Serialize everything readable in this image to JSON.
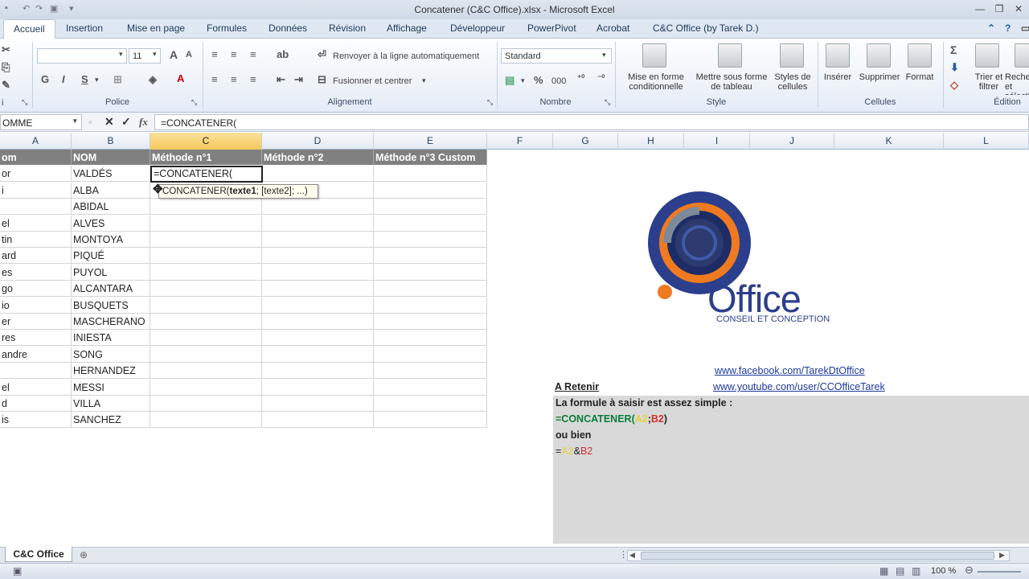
{
  "window": {
    "title": "Concatener (C&C Office).xlsx - Microsoft Excel"
  },
  "ribbon_tabs": [
    "Accueil",
    "Insertion",
    "Mise en page",
    "Formules",
    "Données",
    "Révision",
    "Affichage",
    "Développeur",
    "PowerPivot",
    "Acrobat",
    "C&C Office (by Tarek D.)"
  ],
  "ribbon": {
    "font_size": "11",
    "bold": "G",
    "italic": "I",
    "underline": "S",
    "wrap_text": "Renvoyer à la ligne automatiquement",
    "merge_center": "Fusionner et centrer",
    "number_format": "Standard",
    "percent": "%",
    "thousands": "000",
    "cond_format": "Mise en forme conditionnelle",
    "table_format": "Mettre sous forme de tableau",
    "cell_styles": "Styles de cellules",
    "insert": "Insérer",
    "delete": "Supprimer",
    "format": "Format",
    "sort_filter": "Trier et filtrer",
    "find_select": "Rechercher et sélectionner",
    "groups": {
      "police": "Police",
      "alignement": "Alignement",
      "nombre": "Nombre",
      "style": "Style",
      "cellules": "Cellules",
      "edition": "Édition"
    }
  },
  "formula_bar": {
    "name_box": "OMME",
    "fx": "fx",
    "formula": "=CONCATENER("
  },
  "columns": [
    "A",
    "B",
    "C",
    "D",
    "E",
    "F",
    "G",
    "H",
    "I",
    "J",
    "K",
    "L"
  ],
  "table": {
    "headers": [
      "om",
      "NOM",
      "Méthode n°1",
      "Méthode n°2",
      "Méthode n°3 Custom"
    ],
    "rows": [
      [
        "or",
        "VALDÉS"
      ],
      [
        "i",
        "ALBA"
      ],
      [
        "",
        "ABIDAL"
      ],
      [
        "el",
        "ALVES"
      ],
      [
        "tin",
        "MONTOYA"
      ],
      [
        "ard",
        "PIQUÉ"
      ],
      [
        "es",
        "PUYOL"
      ],
      [
        "go",
        "ALCANTARA"
      ],
      [
        "io",
        "BUSQUETS"
      ],
      [
        "er",
        "MASCHERANO"
      ],
      [
        "res",
        "INIESTA"
      ],
      [
        "andre",
        "SONG"
      ],
      [
        "",
        "HERNANDEZ"
      ],
      [
        "el",
        "MESSI"
      ],
      [
        "d",
        "VILLA"
      ],
      [
        "is",
        "SANCHEZ"
      ]
    ],
    "editing_value": "=CONCATENER(",
    "tooltip_func": "CONCATENER(",
    "tooltip_arg1": "texte1",
    "tooltip_rest": "; [texte2]; ...)"
  },
  "logo": {
    "brand": "Office",
    "tagline": "CONSEIL ET CONCEPTION"
  },
  "links": {
    "facebook": "www.facebook.com/TarekDtOffice",
    "youtube": "www.youtube.com/user/CCOfficeTarek"
  },
  "notes": {
    "title": "A Retenir",
    "line1": "La formule à saisir est assez simple :",
    "f1_eq": "=CONCATENER(",
    "f1_a": "A2",
    "f1_sep": ";",
    "f1_b": "B2",
    "f1_close": ")",
    "or": "ou bien",
    "f2_eq": "=",
    "f2_a": "A2",
    "f2_amp": "&",
    "f2_b": "B2"
  },
  "sheet_tab": "C&C Office",
  "zoom": "100 %",
  "colors": {
    "header_fill": "#808080",
    "selected_col": "#f4c75a",
    "logo_blue": "#2b3f8c",
    "logo_orange": "#f07a20",
    "note_fill": "#d9d9d9",
    "formula_green": "#0a7d3c",
    "ref_yellow": "#e6d23a",
    "ref_red": "#d03030"
  }
}
